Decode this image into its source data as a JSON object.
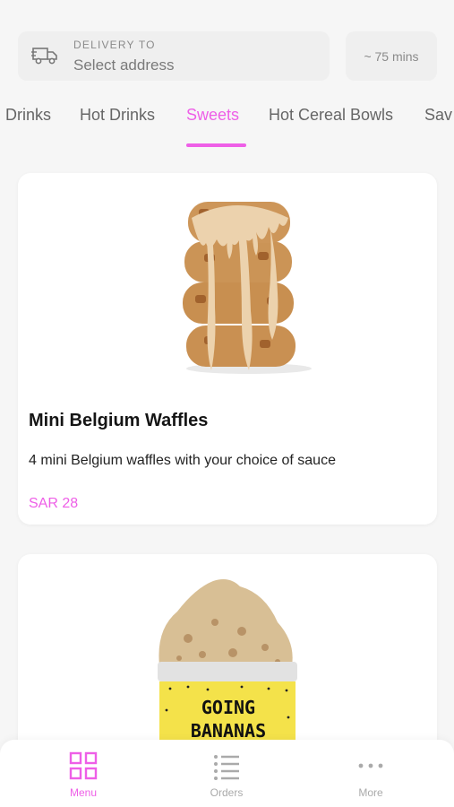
{
  "header": {
    "delivery_caption": "DELIVERY TO",
    "address_placeholder": "Select address",
    "eta": "~ 75 mins",
    "icon": "delivery-truck-icon"
  },
  "tabs": [
    {
      "label": "Drinks"
    },
    {
      "label": "Hot Drinks"
    },
    {
      "label": "Sweets",
      "active": true
    },
    {
      "label": "Hot Cereal Bowls"
    },
    {
      "label": "Sav"
    }
  ],
  "products": [
    {
      "title": "Mini Belgium Waffles",
      "description": "4 mini Belgium waffles with your choice of sauce",
      "price": "SAR 28",
      "image": "stacked-waffles"
    },
    {
      "image": "going-bananas-jar",
      "image_text_1": "GOING",
      "image_text_2": "BANANAS"
    }
  ],
  "bottom_nav": [
    {
      "label": "Menu",
      "icon": "grid-icon",
      "active": true
    },
    {
      "label": "Orders",
      "icon": "list-icon"
    },
    {
      "label": "More",
      "icon": "more-dots-icon"
    }
  ],
  "colors": {
    "accent": "#ee5fe7",
    "background": "#f6f6f6",
    "card": "#ffffff",
    "muted_text": "#8a8a8a"
  }
}
